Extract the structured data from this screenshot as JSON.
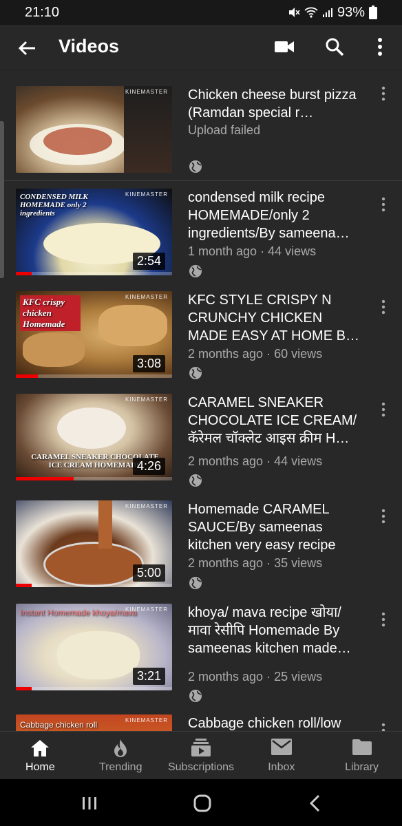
{
  "status": {
    "time": "21:10",
    "battery": "93%"
  },
  "appbar": {
    "title": "Videos"
  },
  "videos": [
    {
      "title": "Chicken cheese burst pizza (Ramdan special r…",
      "meta": "Upload failed",
      "duration": "",
      "progress": 0,
      "overlay": ""
    },
    {
      "title": "condensed milk  recipe HOMEMADE/only 2 ingredients/By sameena…",
      "meta": "1 month ago · 44 views",
      "duration": "2:54",
      "progress": 0.1,
      "overlay": "CONDENSED MILK HOMEMADE only 2 ingredients"
    },
    {
      "title": "KFC STYLE CRISPY N CRUNCHY CHICKEN MADE EASY AT HOME B…",
      "meta": "2 months ago · 60 views",
      "duration": "3:08",
      "progress": 0.14,
      "overlay": "KFC crispy chicken Homemade"
    },
    {
      "title": "CARAMEL SNEAKER CHOCOLATE ICE CREAM/ कॅरेमल चॉक्लेट आइस क्रीम H…",
      "meta": "2 months ago · 44 views",
      "duration": "4:26",
      "progress": 0.37,
      "overlay": "CARAMEL SNEAKER CHOCOLATE ICE CREAM HOMEMADE"
    },
    {
      "title": "Homemade CARAMEL SAUCE/By sameenas kitchen very easy recipe",
      "meta": "2 months ago · 35 views",
      "duration": "5:00",
      "progress": 0.1,
      "overlay": ""
    },
    {
      "title": "khoya/ mava recipe खोया/ मावा रेसीपि Homemade By sameenas kitchen made…",
      "meta": "2 months ago · 25 views",
      "duration": "3:21",
      "progress": 0.1,
      "overlay": "Instant Homemade khoya/mava"
    },
    {
      "title": "Cabbage chicken roll/low",
      "meta": "",
      "duration": "",
      "progress": 0,
      "overlay": "Cabbage chicken roll"
    }
  ],
  "watermark": "KINEMASTER",
  "nav": {
    "home": "Home",
    "trending": "Trending",
    "subscriptions": "Subscriptions",
    "inbox": "Inbox",
    "library": "Library"
  }
}
